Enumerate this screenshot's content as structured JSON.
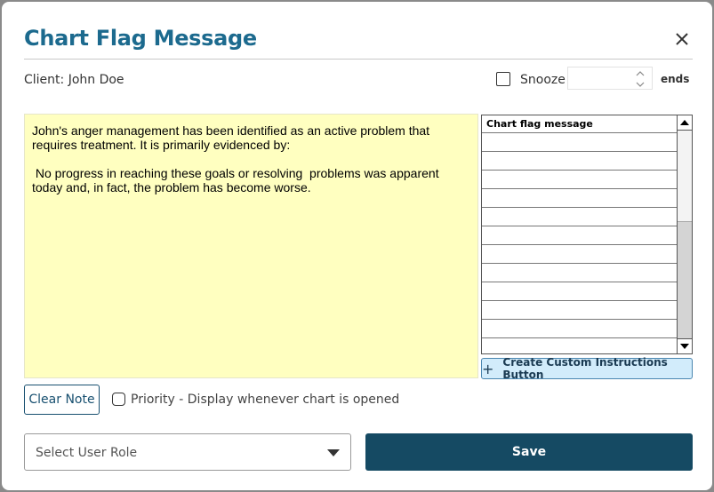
{
  "dialog": {
    "title": "Chart Flag Message",
    "close_icon": "close-icon"
  },
  "header": {
    "client_label": "Client: John Doe",
    "snooze_label": "Snooze",
    "snooze_value": "",
    "ends_label": "ends"
  },
  "note": {
    "text": "John's anger management has been identified as an active problem that requires treatment. It is primarily evidenced by:\n\n No progress in reaching these goals or resolving  problems was apparent today and, in fact, the problem has become worse."
  },
  "message_list": {
    "header": "Chart flag message",
    "rows": [
      "",
      "",
      "",
      "",
      "",
      "",
      "",
      "",
      "",
      "",
      "",
      ""
    ]
  },
  "buttons": {
    "custom_instructions": "Create Custom Instructions Button",
    "clear_note": "Clear Note",
    "save": "Save"
  },
  "priority": {
    "label": "Priority - Display whenever chart is opened"
  },
  "role_select": {
    "placeholder": "Select User Role"
  },
  "colors": {
    "title": "#1c6a8e",
    "note_bg": "#ffffc0",
    "save_bg": "#154a63",
    "custom_btn_bg": "#d2ecfb"
  }
}
